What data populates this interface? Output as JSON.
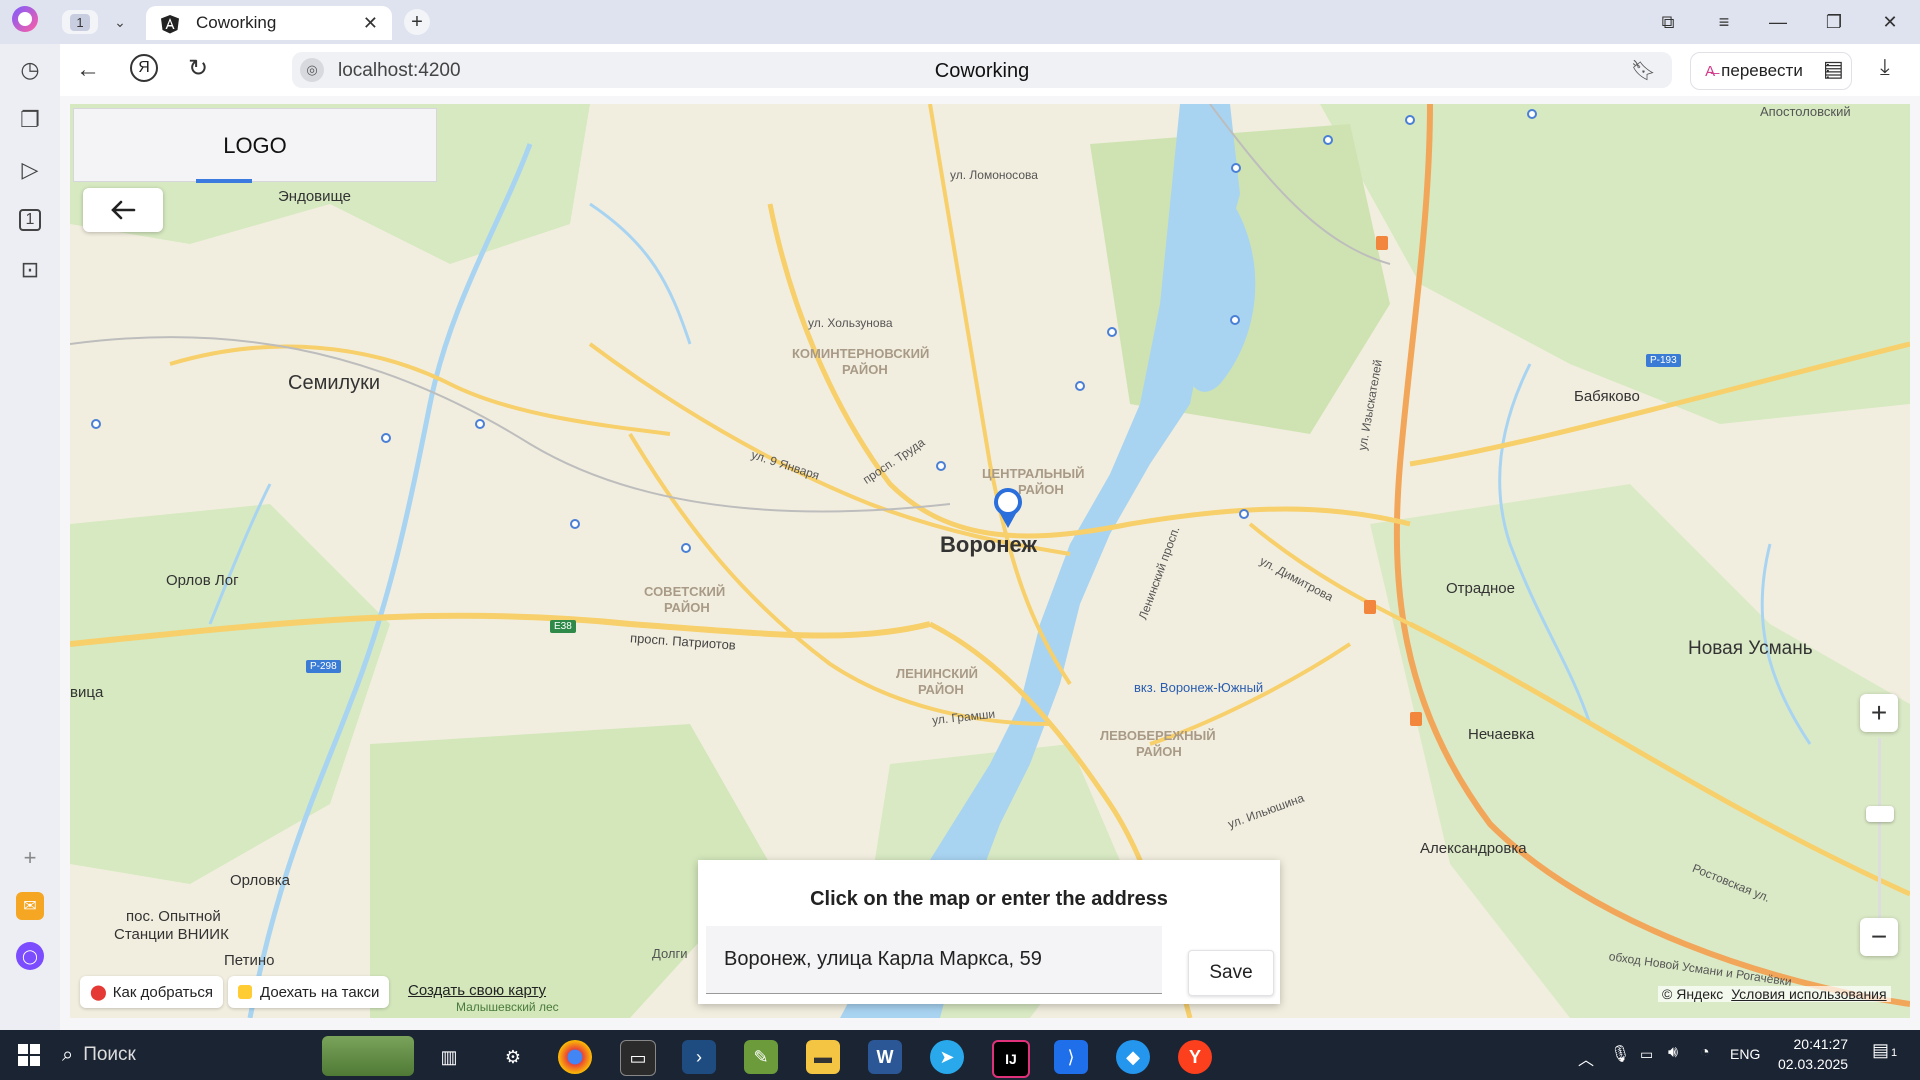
{
  "browser": {
    "tab_count": "1",
    "tab_title": "Coworking",
    "address": "localhost:4200",
    "page_title": "Coworking",
    "translate_label": "перевести"
  },
  "app": {
    "logo": "LOGO",
    "panel_title": "Click on the map or enter the address",
    "address_value": "Воронеж, улица Карла Маркса, 59",
    "save_label": "Save"
  },
  "map": {
    "city_label": "Воронеж",
    "places": [
      {
        "text": "Семилуки"
      },
      {
        "text": "Эндовище"
      },
      {
        "text": "Бабяково"
      },
      {
        "text": "Отрадное"
      },
      {
        "text": "Новая Усмань"
      },
      {
        "text": "Нечаевка"
      },
      {
        "text": "Александровка"
      },
      {
        "text": "Орлов Лог"
      },
      {
        "text": "Орловка"
      },
      {
        "text": "пос. Опытной"
      },
      {
        "text": "Станции ВНИИК"
      },
      {
        "text": "Петино"
      },
      {
        "text": "вица"
      },
      {
        "text": "Апостоловский"
      },
      {
        "text": "Долги"
      }
    ],
    "districts": [
      {
        "text": "КОМИНТЕРНОВСКИЙ"
      },
      {
        "text": "РАЙОН"
      },
      {
        "text": "ЦЕНТРАЛЬНЫЙ"
      },
      {
        "text": "РАЙОН"
      },
      {
        "text": "СОВЕТСКИЙ"
      },
      {
        "text": "РАЙОН"
      },
      {
        "text": "ЛЕНИНСКИЙ"
      },
      {
        "text": "РАЙОН"
      },
      {
        "text": "ЛЕВОБЕРЕЖНЫЙ"
      },
      {
        "text": "РАЙОН"
      }
    ],
    "streets": [
      {
        "text": "ул. Ломоносова"
      },
      {
        "text": "ул. Хользунова"
      },
      {
        "text": "ул. 9 Января"
      },
      {
        "text": "просп. Труда"
      },
      {
        "text": "просп. Патриотов"
      },
      {
        "text": "ул. Грамши"
      },
      {
        "text": "ул. Ильюшина"
      },
      {
        "text": "ул. Димитрова"
      },
      {
        "text": "вкз. Воронеж-Южный"
      },
      {
        "text": "Ленинский просп."
      },
      {
        "text": "ул. Изыскателей"
      },
      {
        "text": "Ростовская ул."
      },
      {
        "text": "обход Новой Усмани и Рогачёвки"
      }
    ],
    "route_badges": [
      "Р-193",
      "Р-298",
      "E38"
    ],
    "copyright": "© Яндекс",
    "terms": "Условия использования",
    "bottom_links": {
      "directions": "Как добраться",
      "taxi": "Доехать на такси",
      "create_map": "Создать свою карту"
    },
    "forest_label": "Малышевский лес"
  },
  "taskbar": {
    "search_placeholder": "Поиск",
    "lang": "ENG",
    "time": "20:41:27",
    "date": "02.03.2025",
    "notif_count": "1"
  },
  "colors": {
    "accent": "#3b7be0",
    "water": "#a8d4f2",
    "park": "#cfe6b8",
    "road": "#f7d36b"
  }
}
